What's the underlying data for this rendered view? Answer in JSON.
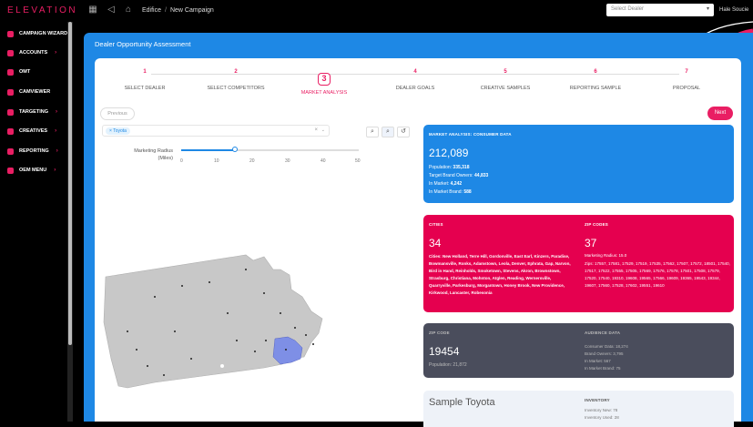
{
  "topbar": {
    "logo": "ELEVATION",
    "crumbs": [
      "Edifice",
      "New Campaign"
    ],
    "dealer_placeholder": "Select Dealer",
    "user": "Hale Soucie"
  },
  "sidebar": {
    "items": [
      {
        "label": "CAMPAIGN WIZARD",
        "icon": "wizard-icon"
      },
      {
        "label": "ACCOUNTS",
        "icon": "accounts-icon"
      },
      {
        "label": "OMT",
        "icon": "omt-icon"
      },
      {
        "label": "CAMVIEWER",
        "icon": "camviewer-icon"
      },
      {
        "label": "TARGETING",
        "icon": "targeting-icon"
      },
      {
        "label": "CREATIVES",
        "icon": "creatives-icon"
      },
      {
        "label": "REPORTING",
        "icon": "reporting-icon"
      },
      {
        "label": "OEM MENU",
        "icon": "oem-icon"
      }
    ]
  },
  "main": {
    "title": "Dealer Opportunity Assessment",
    "steps": [
      {
        "num": "1",
        "label": "SELECT DEALER"
      },
      {
        "num": "2",
        "label": "SELECT COMPETITORS"
      },
      {
        "num": "3",
        "label": "MARKET ANALYSIS"
      },
      {
        "num": "4",
        "label": "DEALER GOALS"
      },
      {
        "num": "5",
        "label": "CREATIVE SAMPLES"
      },
      {
        "num": "6",
        "label": "REPORTING SAMPLE"
      },
      {
        "num": "7",
        "label": "PROPOSAL"
      }
    ],
    "active_step": 3,
    "prev_label": "Previous",
    "next_label": "Next",
    "filter_chip": "Toyota",
    "radius_label": "Marketing Radius (Miles)",
    "radius_ticks": [
      "0",
      "10",
      "20",
      "30",
      "40",
      "50"
    ],
    "radius_value": 15
  },
  "consumer": {
    "header": "MARKET ANALYSIS: CONSUMER DATA",
    "big": "212,089",
    "lines": [
      {
        "k": "Population:",
        "v": "335,318"
      },
      {
        "k": "Target Brand Owners:",
        "v": "44,833"
      },
      {
        "k": "In Market:",
        "v": "4,242"
      },
      {
        "k": "In Market Brand:",
        "v": "588"
      }
    ]
  },
  "cities": {
    "header": "CITIES",
    "big": "34",
    "text": "Cities: New Holland, Terre Hill, Gordonville, East Earl, Kinzers, Paradise, Bowmansville, Ronks, Adamstown, Leola, Denver, Ephrata, Gap, Narvon, Bird in Hand, Reinholds, Smoketown, Stevens, Akron, Brownstown, Strasburg, Christiana, Mohnton, Atglen, Reading, Wernersville, Quarryville, Parkesburg, Morgantown, Honey Brook, New Providence, Kirkwood, Lancaster, Robesonia"
  },
  "zips": {
    "header": "ZIP CODES",
    "big": "37",
    "radius": "Marketing Radius: 15.0",
    "text": "Zips: 17557, 17581, 17529, 17519, 17535, 17562, 17507, 17572, 18501, 17540, 17517, 17522, 17555, 17505, 17569, 17576, 17578, 17501, 17508, 17579, 17520, 17540, 19310, 19608, 19565, 17566, 19609, 19365, 19543, 19344, 19607, 17560, 17528, 17602, 19551, 19610"
  },
  "zipcode": {
    "header": "ZIP CODE",
    "big": "19454",
    "pop": "Population: 21,872"
  },
  "audience": {
    "header": "AUDIENCE DATA",
    "lines": [
      "Consumer Data: 18,274",
      "Brand Owners: 3,795",
      "In Market: 567",
      "In Market Brand: 75"
    ]
  },
  "inventory": {
    "dealer": "Sample Toyota",
    "header": "INVENTORY",
    "lines": [
      "Inventory New: 78",
      "Inventory Used: 28"
    ]
  },
  "colors": {
    "accent": "#e91e63",
    "blue": "#1e88e5",
    "red": "#e5004f",
    "gray": "#4a4d5c"
  }
}
